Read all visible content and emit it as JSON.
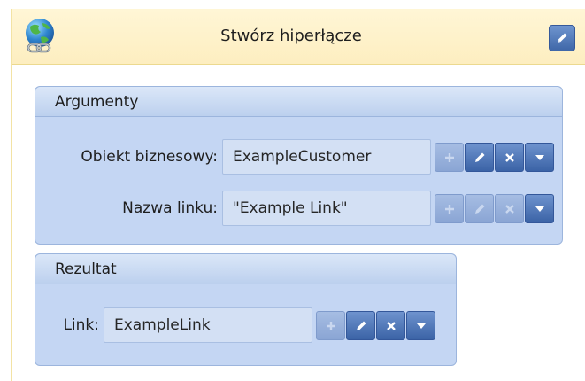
{
  "header": {
    "title": "Stwórz hiperłącze",
    "icon": "globe-link-icon",
    "edit_icon": "pencil-icon",
    "background": "#fdf1c8"
  },
  "arguments_panel": {
    "title": "Argumenty",
    "rows": [
      {
        "label": "Obiekt biznesowy:",
        "value": "ExampleCustomer",
        "buttons": [
          {
            "icon": "plus-icon",
            "enabled": false
          },
          {
            "icon": "pencil-icon",
            "enabled": true
          },
          {
            "icon": "close-icon",
            "enabled": true
          },
          {
            "icon": "dropdown-arrow-icon",
            "enabled": true
          }
        ]
      },
      {
        "label": "Nazwa linku:",
        "value": "\"Example Link\"",
        "buttons": [
          {
            "icon": "plus-icon",
            "enabled": false
          },
          {
            "icon": "pencil-icon",
            "enabled": false
          },
          {
            "icon": "close-icon",
            "enabled": false
          },
          {
            "icon": "dropdown-arrow-icon",
            "enabled": true
          }
        ]
      }
    ]
  },
  "result_panel": {
    "title": "Rezultat",
    "rows": [
      {
        "label": "Link:",
        "value": "ExampleLink",
        "buttons": [
          {
            "icon": "plus-icon",
            "enabled": false
          },
          {
            "icon": "pencil-icon",
            "enabled": true
          },
          {
            "icon": "close-icon",
            "enabled": true
          },
          {
            "icon": "dropdown-arrow-icon",
            "enabled": true
          }
        ]
      }
    ]
  },
  "colors": {
    "panel_bg": "#c4d6f3",
    "button_blue": "#4a70b0",
    "button_disabled": "#98b0dc"
  }
}
